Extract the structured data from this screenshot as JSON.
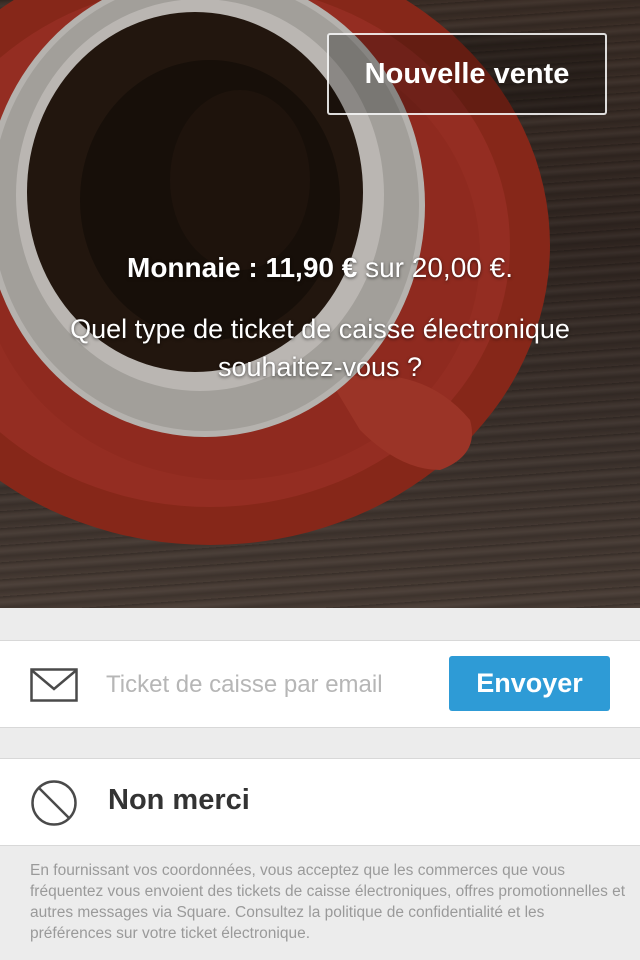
{
  "hero": {
    "new_sale_label": "Nouvelle vente",
    "change_prefix": "Monnaie : 11,90 €",
    "change_suffix": " sur 20,00 €.",
    "question": "Quel type de ticket de caisse électronique souhaitez-vous ?"
  },
  "email_receipt": {
    "icon": "envelope-icon",
    "placeholder": "Ticket de caisse par email",
    "value": "",
    "send_label": "Envoyer"
  },
  "no_receipt": {
    "icon": "no-entry-icon",
    "label": "Non merci"
  },
  "disclaimer": "En fournissant vos coordonnées, vous acceptez que les commerces que vous fréquentez vous envoient des tickets de caisse électroniques, offres promotionnelles et autres messages via Square. Consultez la politique de confidentialité et les préférences sur votre ticket électronique.",
  "colors": {
    "accent": "#2e9bd6",
    "cup_red": "#b5382a",
    "panel_bg": "#ececec"
  }
}
